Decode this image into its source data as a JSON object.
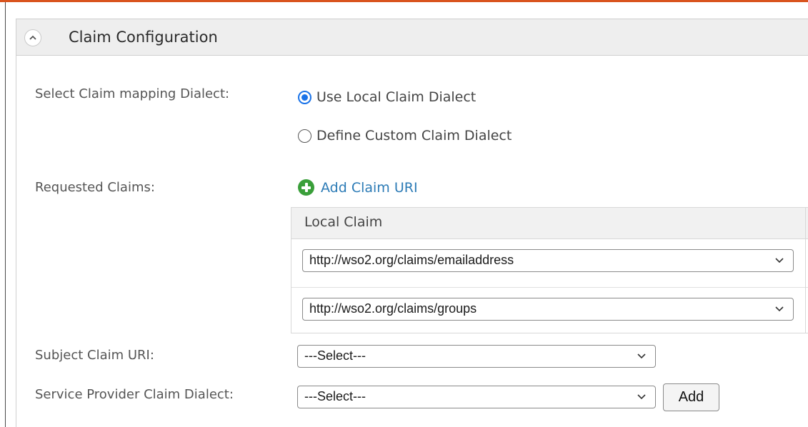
{
  "panel": {
    "title": "Claim Configuration",
    "accent_color": "#d9541e"
  },
  "dialect": {
    "label": "Select Claim mapping Dialect:",
    "options": [
      {
        "label": "Use Local Claim Dialect",
        "checked": true
      },
      {
        "label": "Define Custom Claim Dialect",
        "checked": false
      }
    ]
  },
  "requested_claims": {
    "label": "Requested Claims:",
    "add_link": "Add Claim URI",
    "column_header": "Local Claim",
    "rows": [
      {
        "value": "http://wso2.org/claims/emailaddress"
      },
      {
        "value": "http://wso2.org/claims/groups"
      }
    ]
  },
  "subject_claim": {
    "label": "Subject Claim URI:",
    "selected": "---Select---"
  },
  "sp_dialect": {
    "label": "Service Provider Claim Dialect:",
    "selected": "---Select---",
    "add_button": "Add"
  },
  "icons": {
    "collapse": "chevron-up-icon",
    "add": "plus-circle-icon",
    "dropdown": "chevron-down-icon"
  }
}
